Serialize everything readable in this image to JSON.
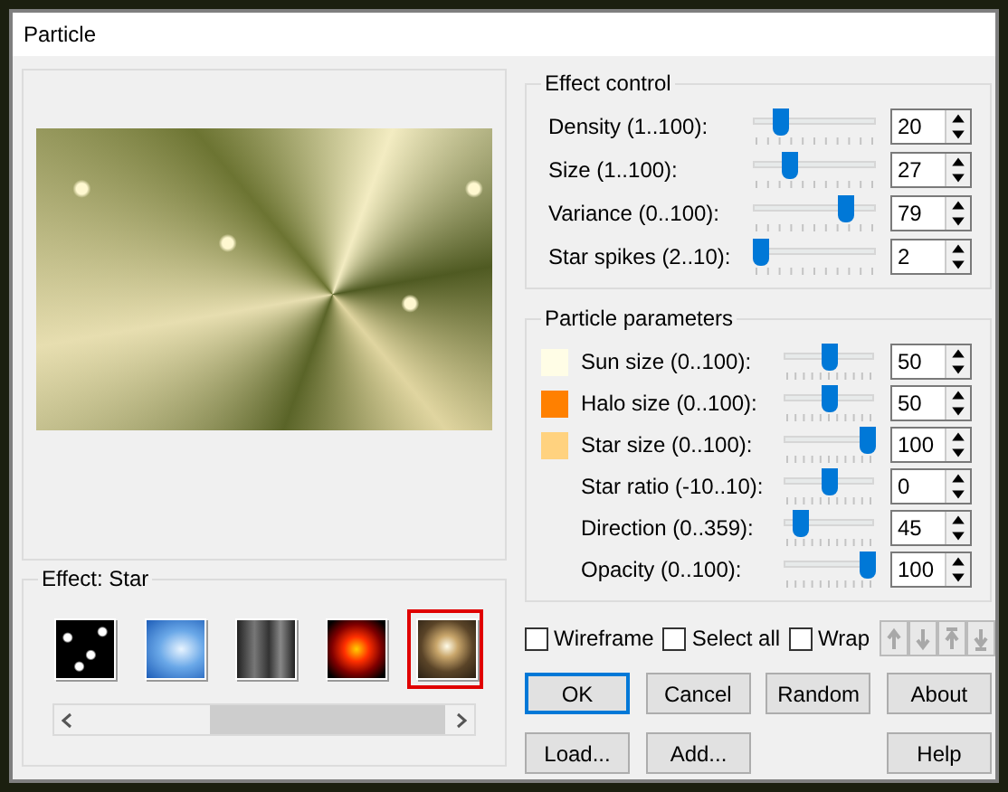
{
  "window": {
    "title": "Particle"
  },
  "effect_control": {
    "title": "Effect control",
    "rows": [
      {
        "label": "Density (1..100):",
        "level": 0.19,
        "value": "20"
      },
      {
        "label": "Size (1..100):",
        "level": 0.26,
        "value": "27"
      },
      {
        "label": "Variance (0..100):",
        "level": 0.78,
        "value": "79"
      },
      {
        "label": "Star spikes (2..10):",
        "level": 0,
        "value": "2"
      }
    ]
  },
  "particle_parameters": {
    "title": "Particle parameters",
    "rows": [
      {
        "kind": "color",
        "color": "#fffde6",
        "label": "Sun size (0..100):",
        "level": 0.5,
        "value": "50"
      },
      {
        "kind": "color",
        "color": "#ff8000",
        "label": "Halo size (0..100):",
        "level": 0.5,
        "value": "50"
      },
      {
        "kind": "color",
        "color": "#ffd27f",
        "label": "Star size (0..100):",
        "level": 1,
        "value": "100"
      },
      {
        "kind": "plain",
        "label": "Star ratio (-10..10):",
        "level": 0.5,
        "value": "0"
      },
      {
        "kind": "plain",
        "label": "Direction (0..359):",
        "level": 0.13,
        "value": "45"
      },
      {
        "kind": "plain",
        "label": "Opacity (0..100):",
        "level": 1,
        "value": "100"
      }
    ]
  },
  "effect": {
    "title": "Effect: Star",
    "thumbnails": [
      {
        "kind": "snow",
        "selected": false
      },
      {
        "kind": "sky",
        "selected": false
      },
      {
        "kind": "smoke",
        "selected": false
      },
      {
        "kind": "fire",
        "selected": false
      },
      {
        "kind": "star",
        "selected": true
      }
    ]
  },
  "checkboxes": [
    {
      "label": "Wireframe",
      "checked": false
    },
    {
      "label": "Select all",
      "checked": false
    },
    {
      "label": "Wrap",
      "checked": false
    }
  ],
  "arrow_buttons": [
    {
      "kind": "up",
      "disabled": true
    },
    {
      "kind": "down",
      "disabled": true
    },
    {
      "kind": "top",
      "disabled": true
    },
    {
      "kind": "bottom",
      "disabled": true
    }
  ],
  "buttons_row_1": [
    {
      "label": "OK",
      "default": true
    },
    {
      "label": "Cancel",
      "default": false
    },
    {
      "label": "Random",
      "default": false
    },
    {
      "label": "About",
      "default": false
    }
  ],
  "buttons_row_2": [
    {
      "label": "Load..."
    },
    {
      "label": "Add..."
    },
    {
      "label": "Help"
    }
  ]
}
